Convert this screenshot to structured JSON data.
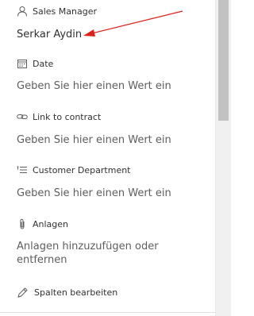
{
  "fields": [
    {
      "label": "Sales Manager",
      "value": "Serkar Aydin",
      "icon": "person-icon",
      "filled": true
    },
    {
      "label": "Date",
      "value": "Geben Sie hier einen Wert ein",
      "icon": "calendar-icon",
      "filled": false
    },
    {
      "label": "Link to contract",
      "value": "Geben Sie hier einen Wert ein",
      "icon": "link-icon",
      "filled": false
    },
    {
      "label": "Customer Department",
      "value": "Geben Sie hier einen Wert ein",
      "icon": "choice-icon",
      "filled": false
    },
    {
      "label": "Anlagen",
      "value": "Anlagen hinzuzufügen oder entfernen",
      "icon": "paperclip-icon",
      "filled": false
    }
  ],
  "edit_columns": {
    "label": "Spalten bearbeiten",
    "icon": "pencil-icon"
  },
  "annotation": {
    "arrow_color": "#d9221c"
  }
}
